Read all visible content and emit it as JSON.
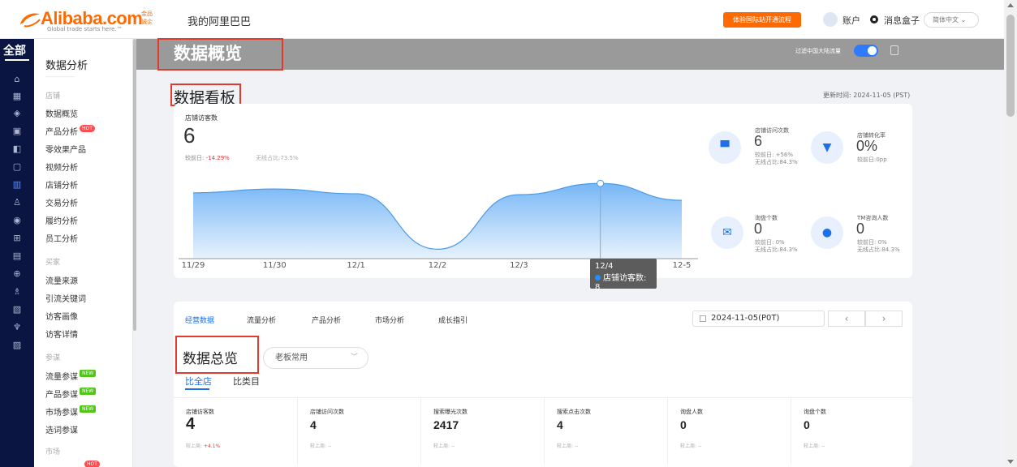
{
  "topbar": {
    "logo_text": "Alibaba.com",
    "logo_tagline": "Global trade starts here.™",
    "logo_badge": "金品诚企",
    "title": "我的阿里巴巴",
    "open_button": "体验国际站开通流程",
    "account": "账户",
    "messages": "消息盒子",
    "language": "简体中文 ⌄"
  },
  "leftnav": {
    "all_label": "全部",
    "icons": [
      "home-icon",
      "shop-icon",
      "shield-icon",
      "card-icon",
      "image-plus-icon",
      "monitor-icon",
      "bar-chart-icon",
      "user-icon",
      "broadcast-icon",
      "layout-icon",
      "document-icon",
      "globe-icon",
      "person-flag-icon",
      "truck-icon",
      "tree-icon",
      "briefcase-icon"
    ]
  },
  "submenu": {
    "title": "数据分析",
    "groups": [
      {
        "label": "店铺",
        "items": [
          {
            "label": "数据概览",
            "badge": ""
          },
          {
            "label": "产品分析",
            "badge": "HOT"
          },
          {
            "label": "零效果产品",
            "badge": ""
          },
          {
            "label": "视频分析",
            "badge": ""
          },
          {
            "label": "店铺分析",
            "badge": ""
          },
          {
            "label": "交易分析",
            "badge": ""
          },
          {
            "label": "履约分析",
            "badge": ""
          },
          {
            "label": "员工分析",
            "badge": ""
          }
        ]
      },
      {
        "label": "买家",
        "items": [
          {
            "label": "流量来源",
            "badge": ""
          },
          {
            "label": "引流关键词",
            "badge": ""
          },
          {
            "label": "访客画像",
            "badge": ""
          },
          {
            "label": "访客详情",
            "badge": ""
          }
        ]
      },
      {
        "label": "参谋",
        "items": [
          {
            "label": "流量参谋",
            "badge": "NEW"
          },
          {
            "label": "产品参谋",
            "badge": "NEW"
          },
          {
            "label": "市场参谋",
            "badge": "NEW"
          },
          {
            "label": "选词参谋",
            "badge": ""
          }
        ]
      },
      {
        "label": "市场",
        "items": [
          {
            "label": "",
            "badge": "HOT"
          }
        ]
      }
    ]
  },
  "header": {
    "page_title": "数据概览",
    "traffic_label": "过滤中国大陆流量",
    "traffic_toggle_on": true
  },
  "board": {
    "title": "数据看板",
    "update_time": "更新时间: 2024-11-05 (PST)",
    "store_visitors": {
      "label": "店铺访客数",
      "value": "6",
      "compare_label": "较前日:",
      "compare_value": "-14.29%",
      "wireless": "无线占比:73.5%"
    },
    "tooltip": {
      "date": "12/4",
      "text": "店铺访客数: 8"
    },
    "metrics": [
      {
        "icon": "storefront-icon",
        "label": "店铺访问次数",
        "value": "6",
        "sub1": "较前日: +56%",
        "sub2": "无线占比:84.3%"
      },
      {
        "icon": "funnel-icon",
        "label": "店铺转化率",
        "value": "0%",
        "sub1": "较前日:0pp",
        "sub2": ""
      },
      {
        "icon": "mail-icon",
        "label": "询盘个数",
        "value": "0",
        "sub1": "较前日: 0%",
        "sub2": "无线占比:84.3%"
      },
      {
        "icon": "tm-icon",
        "label": "TM咨询人数",
        "value": "0",
        "sub1": "较前日: 0%",
        "sub2": "无线占比:84.3%"
      }
    ]
  },
  "chart_data": {
    "type": "area",
    "x": [
      "11/29",
      "11/30",
      "12/1",
      "12/2",
      "12/3",
      "12/4",
      "12-5"
    ],
    "series": [
      {
        "name": "店铺访客数",
        "values": [
          7,
          7.4,
          6.9,
          1,
          6.8,
          8,
          6.2
        ]
      }
    ],
    "ylim": [
      0,
      10
    ],
    "grid": false,
    "color": "#1e90ff"
  },
  "operations": {
    "tabs": [
      "经营数据",
      "流量分析",
      "产品分析",
      "市场分析",
      "成长指引"
    ],
    "active_tab": 0,
    "date": "2024-11-05(P0T)",
    "prev": "‹",
    "next": "›",
    "overview_title": "数据总览",
    "select_value": "老板常用",
    "subtabs": [
      "比全店",
      "比类目"
    ],
    "stats": [
      {
        "label": "店铺访客数",
        "value": "4",
        "compare_label": "较上周:",
        "compare_value": "+4.1%"
      },
      {
        "label": "店铺访问次数",
        "value": "4",
        "compare_label": "较上周:",
        "compare_value": "--"
      },
      {
        "label": "搜索曝光次数",
        "value": "2417",
        "compare_label": "较上周:",
        "compare_value": "--"
      },
      {
        "label": "搜索点击次数",
        "value": "4",
        "compare_label": "较上周:",
        "compare_value": "--"
      },
      {
        "label": "询盘人数",
        "value": "0",
        "compare_label": "较上周:",
        "compare_value": "--"
      },
      {
        "label": "询盘个数",
        "value": "0",
        "compare_label": "较上周:",
        "compare_value": "--"
      }
    ]
  },
  "colors": {
    "brand": "#ff6a00",
    "accent": "#1f6fe6",
    "nav_bg": "#0a1542",
    "annotation_red": "#e03a2d"
  }
}
